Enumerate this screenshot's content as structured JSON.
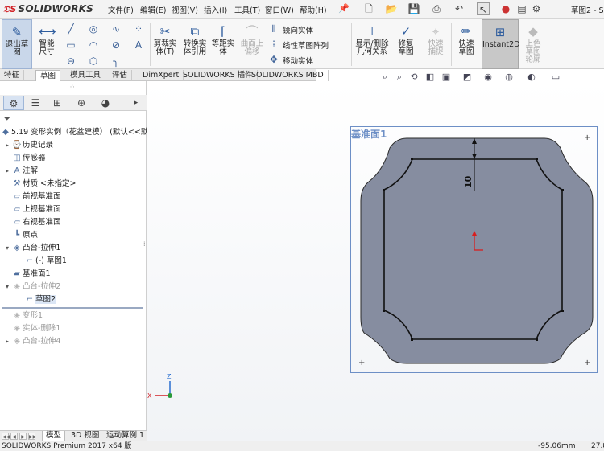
{
  "app": {
    "logo": "SOLIDWORKS",
    "document_title": "草图2 - S"
  },
  "menu": [
    "文件(F)",
    "编辑(E)",
    "视图(V)",
    "插入(I)",
    "工具(T)",
    "窗口(W)",
    "帮助(H)"
  ],
  "commands": {
    "exit_sketch": "退出草图",
    "smart_dimension": "智能尺寸",
    "trim": "剪裁实体(T)",
    "convert": "转换实体引用",
    "offset": "等距实体",
    "surface_offset": "曲面上偏移",
    "mirror": "镜向实体",
    "linear_pattern": "线性草图阵列",
    "move": "移动实体",
    "display_relations": "显示/删除几何关系",
    "repair": "修复草图",
    "quick_snap": "快速捕捉",
    "rapid_sketch": "快速草图",
    "instant2d": "Instant2D",
    "shaded_sketch": "上色草图轮廓"
  },
  "tabs": [
    "特征",
    "草图",
    "模具工具",
    "评估",
    "DimXpert",
    "SOLIDWORKS 插件",
    "SOLIDWORKS MBD"
  ],
  "active_tab": "草图",
  "tree": {
    "root": "5.19 变形实例（花盆建模）  (默认<<默认",
    "items": [
      {
        "label": "历史记录",
        "icon": "history-icon"
      },
      {
        "label": "传感器",
        "icon": "sensor-icon"
      },
      {
        "label": "注解",
        "icon": "annotation-icon"
      },
      {
        "label": "材质 <未指定>",
        "icon": "material-icon"
      },
      {
        "label": "前视基准面",
        "icon": "plane-icon"
      },
      {
        "label": "上视基准面",
        "icon": "plane-icon"
      },
      {
        "label": "右视基准面",
        "icon": "plane-icon"
      },
      {
        "label": "原点",
        "icon": "origin-icon"
      },
      {
        "label": "凸台-拉伸1",
        "icon": "extrude-icon"
      },
      {
        "label": "(-) 草图1",
        "icon": "sketch-icon"
      },
      {
        "label": "基准面1",
        "icon": "plane-icon"
      },
      {
        "label": "凸台-拉伸2",
        "icon": "extrude-icon"
      },
      {
        "label": "草图2",
        "icon": "sketch-icon"
      },
      {
        "label": "变形1",
        "icon": "deform-icon"
      },
      {
        "label": "实体-删除1",
        "icon": "delete-body-icon"
      },
      {
        "label": "凸台-拉伸4",
        "icon": "extrude-icon"
      }
    ]
  },
  "bottom_tabs": [
    "模型",
    "3D 视图",
    "运动算例 1"
  ],
  "viewport": {
    "plane_label": "基准面1",
    "dimension": "10"
  },
  "status": {
    "product": "SOLIDWORKS Premium 2017 x64 版",
    "x_coord": "-95.06mm",
    "y_coord": "27.8"
  },
  "colors": {
    "accent": "#6d8fc6",
    "brand": "#d11f24",
    "face": "#868da0",
    "selection": "#dbe6f5"
  }
}
